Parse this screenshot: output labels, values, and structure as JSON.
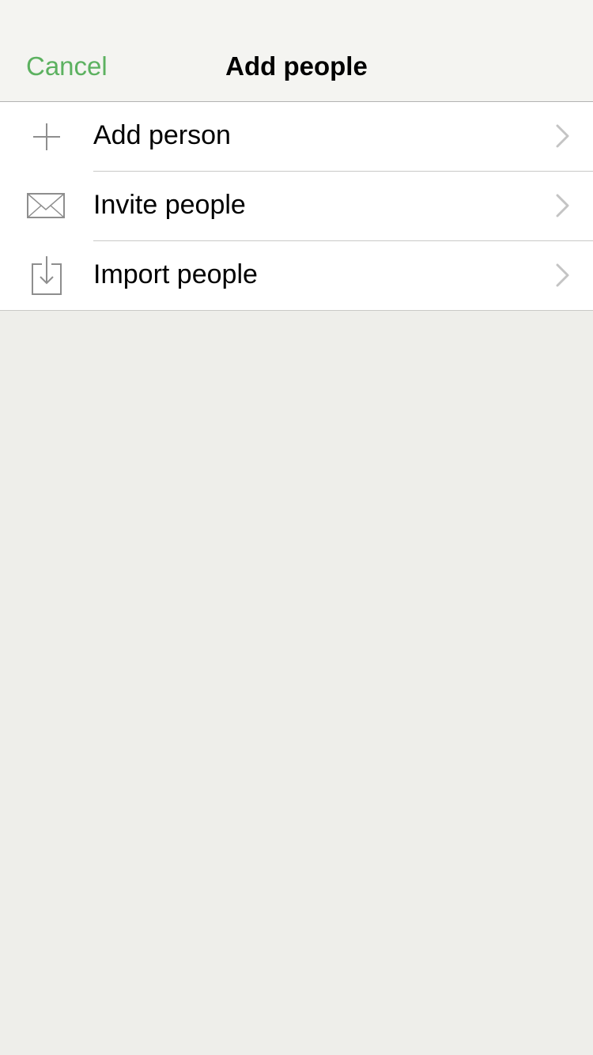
{
  "navbar": {
    "cancel_label": "Cancel",
    "title": "Add people"
  },
  "menu": {
    "items": [
      {
        "label": "Add person",
        "icon": "plus-icon"
      },
      {
        "label": "Invite people",
        "icon": "envelope-icon"
      },
      {
        "label": "Import people",
        "icon": "import-download-icon"
      }
    ]
  },
  "colors": {
    "accent": "#5cb160",
    "background": "#eeeeea",
    "navbar_background": "#f4f4f1",
    "icon_gray": "#8e8e8e",
    "chevron_gray": "#c4c4c4"
  }
}
